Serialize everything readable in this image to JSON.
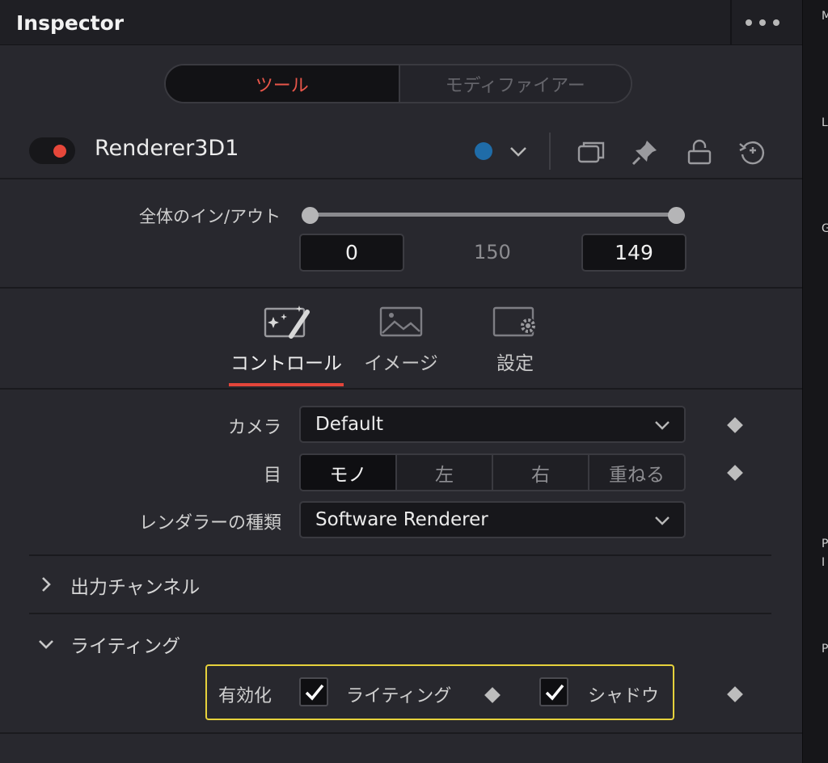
{
  "header": {
    "title": "Inspector"
  },
  "right_strip": {
    "labels": [
      "M",
      "La",
      "Go",
      "P",
      "I",
      "P"
    ]
  },
  "mode_tabs": [
    {
      "label": "ツール",
      "active": true
    },
    {
      "label": "モディファイアー",
      "active": false
    }
  ],
  "node": {
    "name": "Renderer3D1",
    "enabled": true,
    "toggle_color": "#e6473a",
    "node_color": "#1f6ca8",
    "tool_icons": [
      "versions-icon",
      "pin-icon",
      "lock-icon",
      "reset-icon"
    ]
  },
  "global_in_out": {
    "label": "全体のイン/アウト",
    "in_value": "0",
    "duration": "150",
    "out_value": "149"
  },
  "sub_tabs": [
    {
      "label": "コントロール",
      "icon": "controls-wand-icon",
      "active": true
    },
    {
      "label": "イメージ",
      "icon": "image-icon",
      "active": false
    },
    {
      "label": "設定",
      "icon": "settings-gear-icon",
      "active": false
    }
  ],
  "controls": {
    "camera": {
      "label": "カメラ",
      "value": "Default"
    },
    "eye": {
      "label": "目",
      "options": [
        "モノ",
        "左",
        "右",
        "重ねる"
      ],
      "selected": "モノ"
    },
    "renderer_type": {
      "label": "レンダラーの種類",
      "value": "Software Renderer"
    }
  },
  "sections": {
    "output_channels": {
      "label": "出力チャンネル",
      "expanded": false
    },
    "lighting": {
      "label": "ライティング",
      "expanded": true
    }
  },
  "lighting_enable": {
    "label": "有効化",
    "lighting": {
      "label": "ライティング",
      "checked": true
    },
    "shadow": {
      "label": "シャドウ",
      "checked": true
    }
  },
  "accent_colors": {
    "active_tab": "#e3453a",
    "highlight_box": "#e6d23c"
  }
}
